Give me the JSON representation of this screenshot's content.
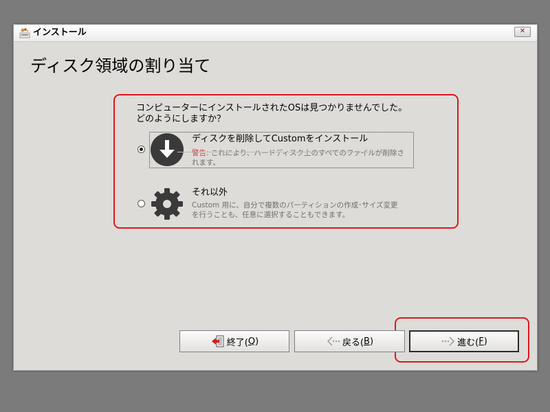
{
  "window": {
    "title": "インストール"
  },
  "page": {
    "title": "ディスク領域の割り当て"
  },
  "question": {
    "line1": "コンピューターにインストールされたOSは見つかりませんでした。",
    "line2": "どのようにしますか？"
  },
  "options": [
    {
      "title": "ディスクを削除してCustomをインストール",
      "warning_label": "警告:",
      "desc_line1": " これにより、ハードディスク上のすべてのファイルが削除さ",
      "desc_line2": "れます。",
      "selected": true,
      "icon": "download-arrow-icon"
    },
    {
      "title": "それ以外",
      "desc_line1": "Custom 用に、自分で複数のパーティションの作成･サイズ変更",
      "desc_line2": "を行うことも、任意に選択することもできます。",
      "selected": false,
      "icon": "gear-icon"
    }
  ],
  "buttons": {
    "quit": {
      "label": "終了(",
      "mnemonic": "Q",
      "end": ")"
    },
    "back": {
      "label": "戻る(",
      "mnemonic": "B",
      "end": ")"
    },
    "forward": {
      "label": "進む(",
      "mnemonic": "F",
      "end": ")"
    }
  },
  "colors": {
    "highlight": "#e0161c",
    "warning": "#d23c3c"
  }
}
